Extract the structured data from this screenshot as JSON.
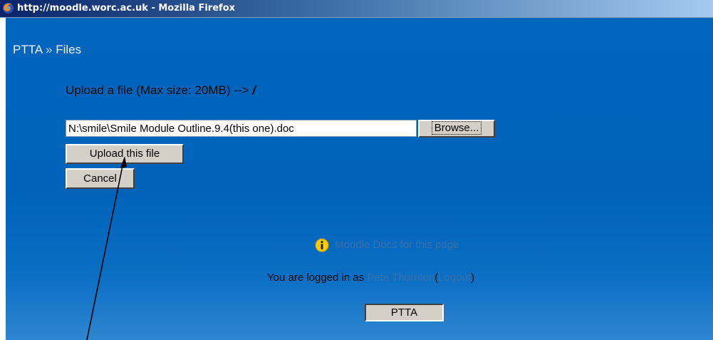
{
  "window": {
    "title": "http://moodle.worc.ac.uk - Mozilla Firefox",
    "icon": "firefox-icon"
  },
  "breadcrumb": {
    "root": "PTTA",
    "separator": "»",
    "current": "Files"
  },
  "upload": {
    "heading": "Upload a file (Max size: 20MB) -->",
    "path_indicator": "/",
    "file_value": "N:\\smile\\Smile Module Outline.9.4(this one).doc",
    "browse_label": "Browse...",
    "upload_label": "Upload this file",
    "cancel_label": "Cancel"
  },
  "footer": {
    "docs_icon": "info-icon",
    "docs_link": "Moodle Docs for this page",
    "logged_in_prefix": "You are logged in as",
    "user_name": "Pete Thornton",
    "logout_open": "(",
    "logout_label": "Logout",
    "logout_close": ")",
    "course_button": "PTTA"
  },
  "colors": {
    "page_background": "#0063ba",
    "link": "#3b6faa",
    "button_face": "#d4d0c8"
  }
}
